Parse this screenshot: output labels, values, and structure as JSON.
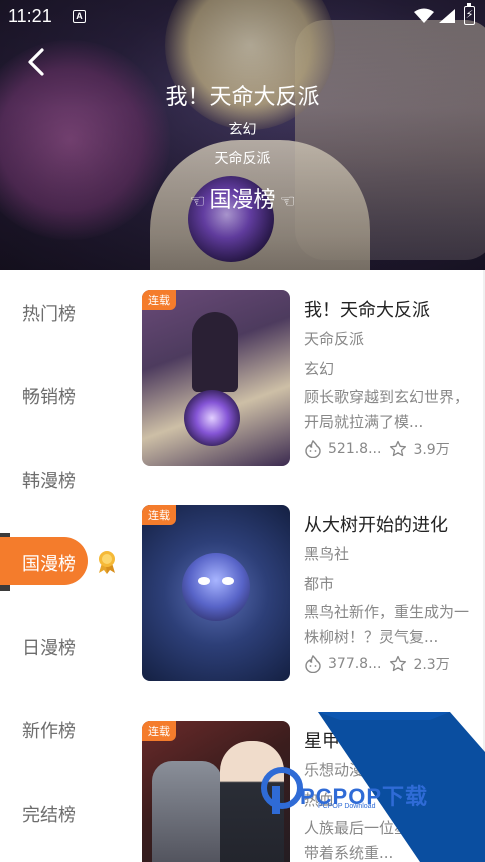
{
  "status_bar": {
    "time": "11:21",
    "notification_icon": "A"
  },
  "hero": {
    "title": "我！天命大反派",
    "genre": "玄幻",
    "author": "天命反派",
    "ranking": "国漫榜"
  },
  "sidebar": {
    "items": [
      "热门榜",
      "畅销榜",
      "韩漫榜",
      "国漫榜",
      "日漫榜",
      "新作榜",
      "完结榜"
    ],
    "active_index": 3,
    "active_label": "国漫榜",
    "accent_color": "#f47c2c"
  },
  "list": [
    {
      "badge": "连载",
      "title": "我！天命大反派",
      "author": "天命反派",
      "genre": "玄幻",
      "description": "顾长歌穿越到玄幻世界，开局就拉满了模...",
      "views": "521.8...",
      "favorites": "3.9万"
    },
    {
      "badge": "连载",
      "title": "从大树开始的进化",
      "author": "黑鸟社",
      "genre": "都市",
      "description": "黑鸟社新作，重生成为一株柳树！？灵气复...",
      "views": "377.8...",
      "favorites": "2.3万"
    },
    {
      "badge": "连载",
      "title": "星甲",
      "author": "乐想动漫",
      "genre": "热血",
      "description": "人族最后一位星甲云祥，带着系统重..."
    }
  ],
  "watermark": {
    "text": "PCPOP下载",
    "sub": "PCPOP Download"
  },
  "icons": {
    "back": "chevron-left-icon",
    "views": "fire-face-icon",
    "favorites": "star-icon",
    "medal": "medal-icon"
  }
}
